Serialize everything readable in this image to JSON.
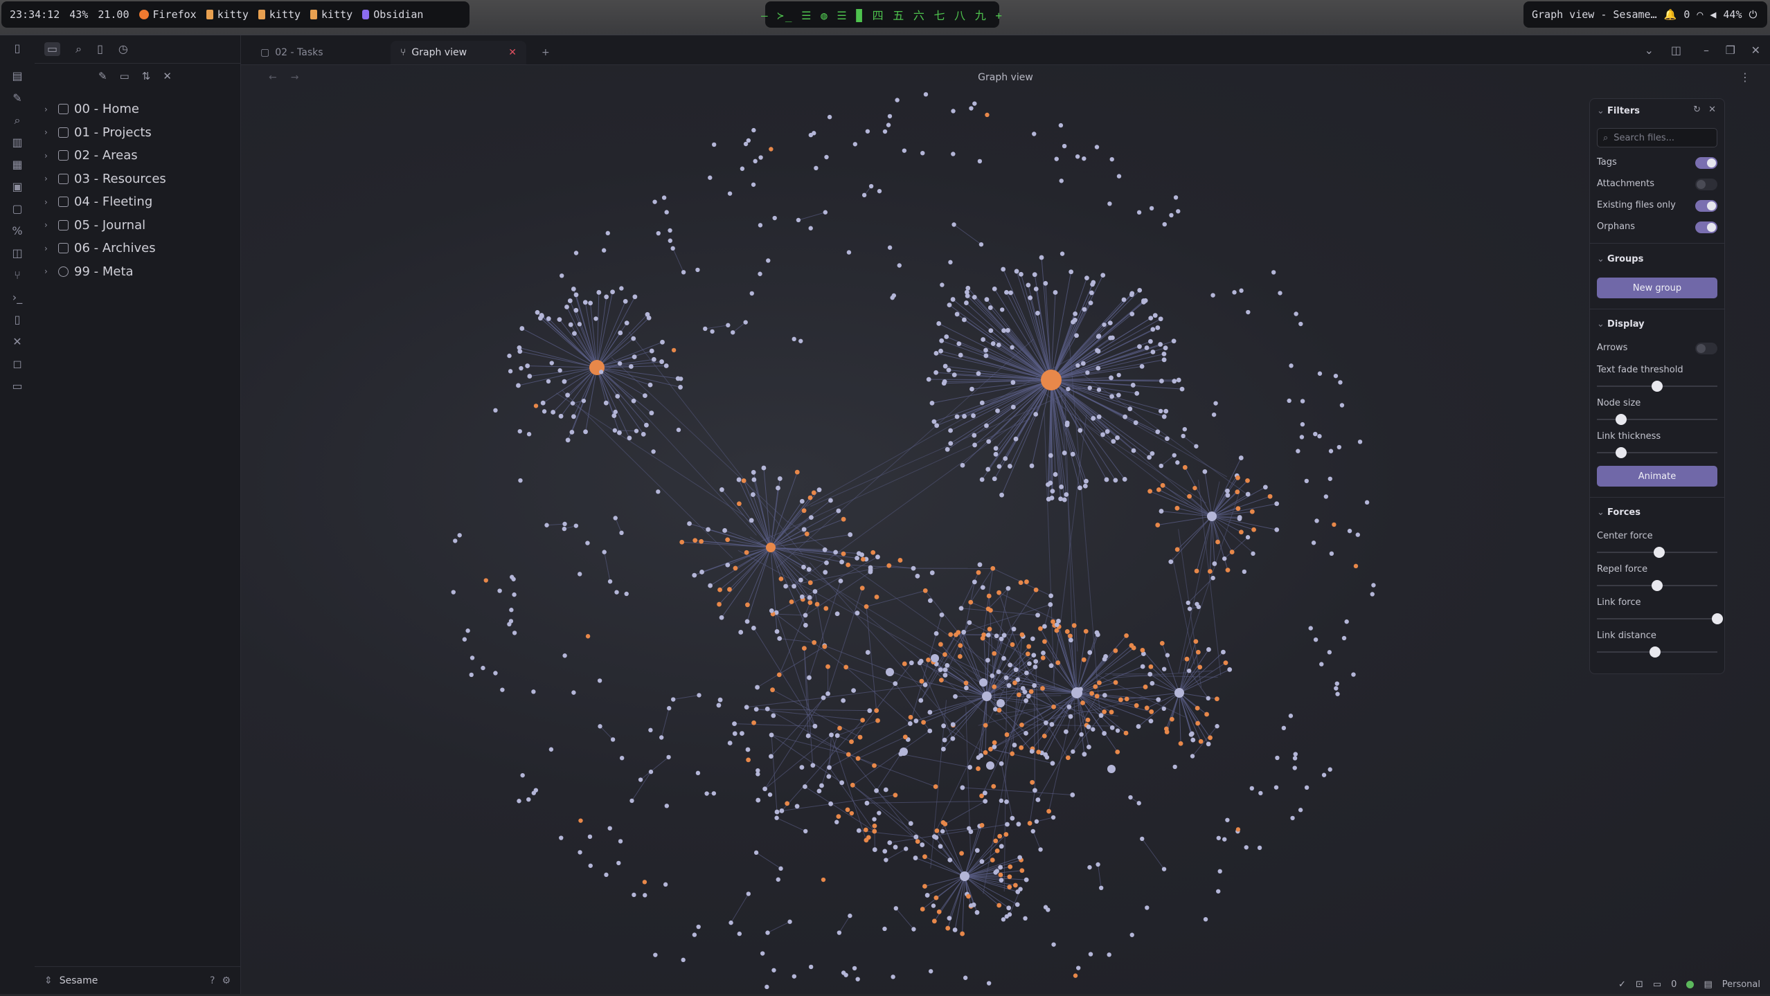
{
  "topbar": {
    "left": {
      "time": "23:34:12",
      "battery_pct": "43%",
      "volume": "21.00",
      "apps": [
        {
          "label": "Firefox",
          "icon": "firefox-icon",
          "color": "#f07a30"
        },
        {
          "label": "kitty",
          "icon": "kitty-icon",
          "color": "#e8a050"
        },
        {
          "label": "kitty",
          "icon": "kitty-icon",
          "color": "#e8a050"
        },
        {
          "label": "kitty",
          "icon": "kitty-icon",
          "color": "#e8a050"
        },
        {
          "label": "Obsidian",
          "icon": "obsidian-icon",
          "color": "#8b6cf0"
        }
      ]
    },
    "center": {
      "workspaces": "— ≻_ ☰ ◍ ☰ ▉ 四 五 六 七 八 九 +"
    },
    "right": {
      "window_title": "Graph view - Sesame…",
      "notifications": "0",
      "battery": "44%"
    }
  },
  "sidebar": {
    "folders": [
      {
        "label": "00 - Home",
        "icon": "home-icon"
      },
      {
        "label": "01 - Projects",
        "icon": "projects-icon"
      },
      {
        "label": "02 - Areas",
        "icon": "areas-icon"
      },
      {
        "label": "03 - Resources",
        "icon": "resources-icon"
      },
      {
        "label": "04 - Fleeting",
        "icon": "fleeting-icon"
      },
      {
        "label": "05 - Journal",
        "icon": "journal-icon"
      },
      {
        "label": "06 - Archives",
        "icon": "archives-icon"
      },
      {
        "label": "99 - Meta",
        "icon": "meta-icon"
      }
    ],
    "vault_name": "Sesame"
  },
  "tabs": [
    {
      "label": "02 - Tasks",
      "active": false
    },
    {
      "label": "Graph view",
      "active": true
    }
  ],
  "view": {
    "title": "Graph view"
  },
  "panel": {
    "filters_title": "Filters",
    "search_placeholder": "Search files...",
    "filters": [
      {
        "label": "Tags",
        "on": true
      },
      {
        "label": "Attachments",
        "on": false
      },
      {
        "label": "Existing files only",
        "on": true
      },
      {
        "label": "Orphans",
        "on": true
      }
    ],
    "groups_title": "Groups",
    "new_group": "New group",
    "display_title": "Display",
    "arrows_label": "Arrows",
    "arrows_on": false,
    "display_sliders": [
      {
        "label": "Text fade threshold",
        "value": 0.5
      },
      {
        "label": "Node size",
        "value": 0.2
      },
      {
        "label": "Link thickness",
        "value": 0.2
      }
    ],
    "animate": "Animate",
    "forces_title": "Forces",
    "forces_sliders": [
      {
        "label": "Center force",
        "value": 0.52
      },
      {
        "label": "Repel force",
        "value": 0.5
      },
      {
        "label": "Link force",
        "value": 1.0
      },
      {
        "label": "Link distance",
        "value": 0.48
      }
    ]
  },
  "status": {
    "comments": "0",
    "profile": "Personal"
  },
  "colors": {
    "node": "#b4b6d8",
    "tag_node": "#e8884a",
    "link": "#5a5e86",
    "accent": "#7068a8"
  }
}
